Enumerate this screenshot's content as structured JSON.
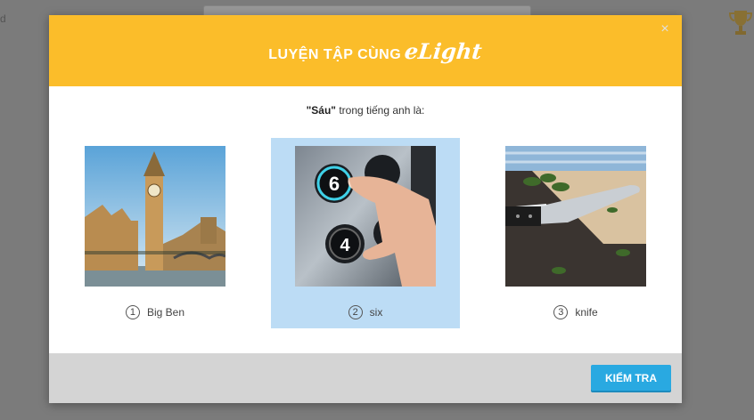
{
  "background": {
    "left_text": "d"
  },
  "modal": {
    "title": "LUYỆN TẬP CÙNG",
    "brand": "eLight",
    "close_label": "×",
    "question_word": "\"Sáu\"",
    "question_rest": " trong tiếng anh là:",
    "options": [
      {
        "number": "1",
        "label": "Big Ben",
        "selected": false,
        "image": "big-ben-photo"
      },
      {
        "number": "2",
        "label": "six",
        "selected": true,
        "image": "elevator-buttons-photo"
      },
      {
        "number": "3",
        "label": "knife",
        "selected": false,
        "image": "knife-photo"
      }
    ],
    "check_button": "KIỂM TRA"
  },
  "colors": {
    "header": "#fbbd2a",
    "selected": "#bcdcf5",
    "button": "#29a9e1",
    "footer": "#d4d4d4"
  }
}
